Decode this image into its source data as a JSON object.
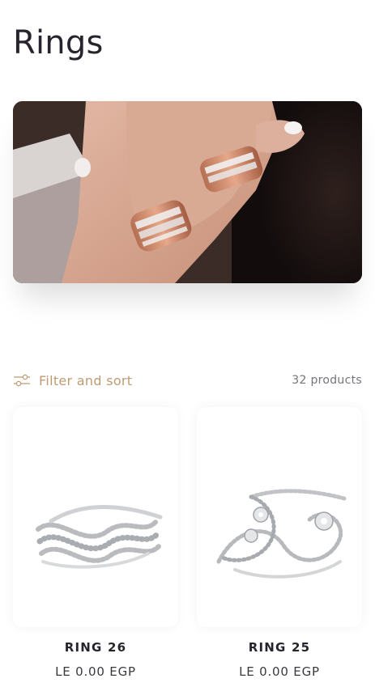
{
  "page": {
    "title": "Rings"
  },
  "hero": {
    "image": "model-hand-wearing-rose-gold-diamond-rings"
  },
  "toolbar": {
    "filter_label": "Filter and sort",
    "filter_icon": "sliders-icon",
    "product_count": "32 products"
  },
  "products": [
    {
      "title": "RING 26",
      "price": "LE 0.00 EGP",
      "image": "silver-multi-band-wave-ring"
    },
    {
      "title": "RING 25",
      "price": "LE 0.00 EGP",
      "image": "silver-crossover-diamond-ring"
    }
  ],
  "colors": {
    "accent": "#c09a73",
    "text": "#28242d",
    "muted": "#78737a"
  }
}
